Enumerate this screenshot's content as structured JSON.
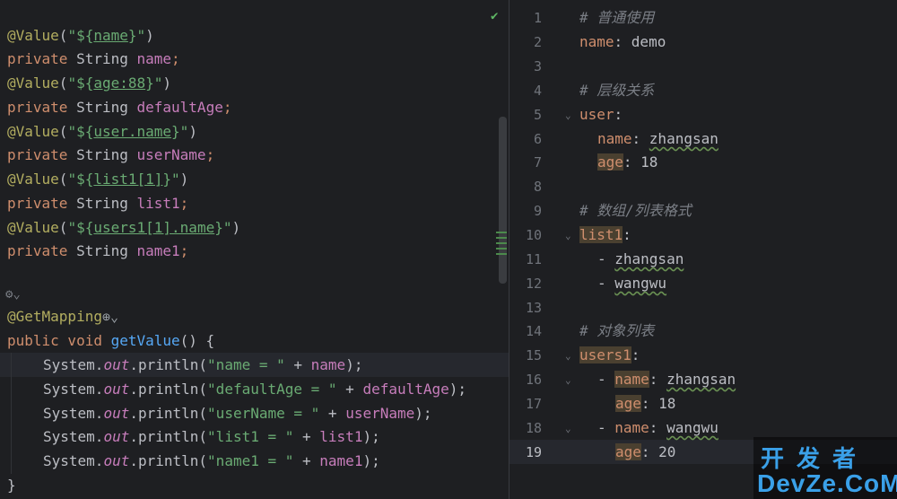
{
  "left": {
    "line1": {
      "ann": "@Value",
      "p1": "(",
      "s1": "\"${",
      "s2": "name",
      "s3": "}\"",
      "p2": ")"
    },
    "line2": {
      "kw": "private",
      "type": " String ",
      "field": "name",
      "end": ";"
    },
    "line3": {
      "ann": "@Value",
      "p1": "(",
      "s1": "\"${",
      "s2": "age:88",
      "s3": "}\"",
      "p2": ")"
    },
    "line4": {
      "kw": "private",
      "type": " String ",
      "field": "defaultAge",
      "end": ";"
    },
    "line5": {
      "ann": "@Value",
      "p1": "(",
      "s1": "\"${",
      "s2": "user.name",
      "s3": "}\"",
      "p2": ")"
    },
    "line6": {
      "kw": "private",
      "type": " String ",
      "field": "userName",
      "end": ";"
    },
    "line7": {
      "ann": "@Value",
      "p1": "(",
      "s1": "\"${",
      "s2": "list1[1]",
      "s3": "}\"",
      "p2": ")"
    },
    "line8": {
      "kw": "private",
      "type": " String ",
      "field": "list1",
      "end": ";"
    },
    "line9": {
      "ann": "@Value",
      "p1": "(",
      "s1": "\"${",
      "s2": "users1[1].name",
      "s3": "}\"",
      "p2": ")"
    },
    "line10": {
      "kw": "private",
      "type": " String ",
      "field": "name1",
      "end": ";"
    },
    "getmapping": "@GetMapping",
    "method": {
      "kw": "public void ",
      "name": "getValue",
      "rest": "() {"
    },
    "prints": [
      {
        "label": "\"name = \"",
        "var": "name"
      },
      {
        "label": "\"defaultAge = \"",
        "var": "defaultAge"
      },
      {
        "label": "\"userName = \"",
        "var": "userName"
      },
      {
        "label": "\"list1 = \"",
        "var": "list1"
      },
      {
        "label": "\"name1 = \"",
        "var": "name1"
      }
    ],
    "sys": "System.",
    "out": "out",
    "println": ".println(",
    "plus": " + ",
    "close": ");",
    "brace": "}"
  },
  "right": {
    "line_numbers": [
      "1",
      "2",
      "3",
      "4",
      "5",
      "6",
      "7",
      "8",
      "9",
      "10",
      "11",
      "12",
      "13",
      "14",
      "15",
      "16",
      "17",
      "18",
      "19"
    ],
    "c1": "# 普通使用",
    "l2k": "name",
    "l2v": ": demo",
    "c4": "# 层级关系",
    "l5k": "user",
    "l5v": ":",
    "l6k": "name",
    "l6v": ": ",
    "l6s": "zhangsan",
    "l7k": "age",
    "l7v": ": 18",
    "c9": "# 数组/列表格式",
    "l10k": "list1",
    "l10v": ":",
    "l11d": "- ",
    "l11v": "zhangsan",
    "l12d": "- ",
    "l12v": "wangwu",
    "c14": "# 对象列表",
    "l15k": "users1",
    "l15v": ":",
    "l16d": "- ",
    "l16k": "name",
    "l16v": ": ",
    "l16s": "zhangsan",
    "l17k": "age",
    "l17v": ": 18",
    "l18d": "- ",
    "l18k": "name",
    "l18v": ": ",
    "l18s": "wangwu",
    "l19k": "age",
    "l19v": ": 20"
  },
  "watermark": {
    "cn": "开发者",
    "en": "DevZe.CoM"
  }
}
